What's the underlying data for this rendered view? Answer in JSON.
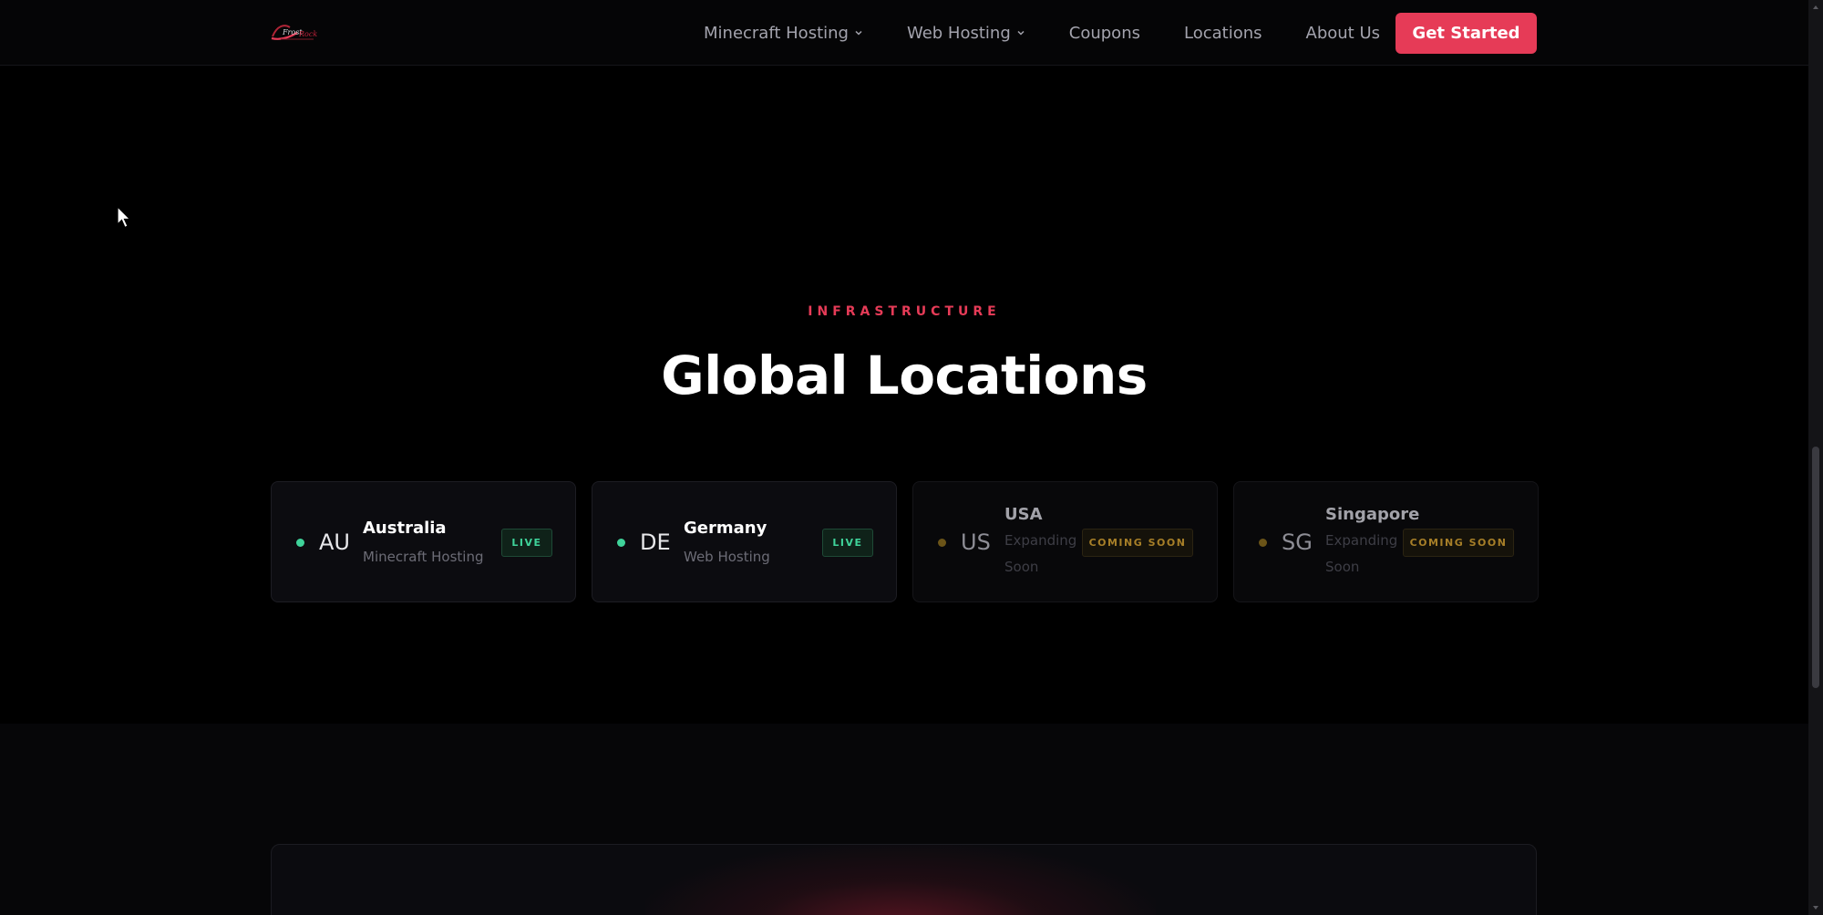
{
  "nav": {
    "logo_icon": "brand-logo-icon",
    "items": [
      {
        "label": "Minecraft Hosting",
        "dropdown": true
      },
      {
        "label": "Web Hosting",
        "dropdown": true
      },
      {
        "label": "Coupons",
        "dropdown": false
      },
      {
        "label": "Locations",
        "dropdown": false
      },
      {
        "label": "About Us",
        "dropdown": false
      }
    ],
    "cta_label": "Get Started"
  },
  "section": {
    "eyebrow": "INFRASTRUCTURE",
    "title": "Global Locations"
  },
  "locations": [
    {
      "code": "AU",
      "name": "Australia",
      "subtitle": "Minecraft Hosting",
      "status": "LIVE",
      "dimmed": false
    },
    {
      "code": "DE",
      "name": "Germany",
      "subtitle": "Web Hosting",
      "status": "LIVE",
      "dimmed": false
    },
    {
      "code": "US",
      "name": "USA",
      "subtitle": "Expanding Soon",
      "status": "COMING SOON",
      "dimmed": true
    },
    {
      "code": "SG",
      "name": "Singapore",
      "subtitle": "Expanding Soon",
      "status": "COMING SOON",
      "dimmed": true
    }
  ],
  "colors": {
    "accent": "#e63b57",
    "live": "#3fd39a",
    "soon": "#a77f28",
    "background": "#000000"
  }
}
